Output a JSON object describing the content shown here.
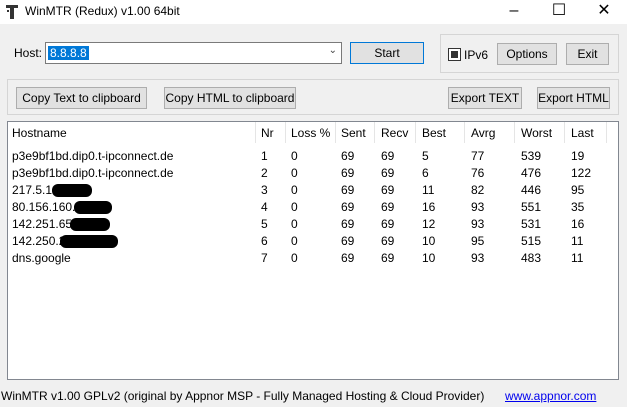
{
  "window": {
    "title": "WinMTR (Redux) v1.00 64bit",
    "minimize_glyph": "–",
    "maximize_glyph": "☐",
    "close_glyph": "✕"
  },
  "host": {
    "label": "Host:",
    "value": "8.8.8.8"
  },
  "buttons": {
    "start": "Start",
    "options": "Options",
    "exit": "Exit",
    "copy_text": "Copy Text to clipboard",
    "copy_html": "Copy HTML to clipboard",
    "export_text": "Export TEXT",
    "export_html": "Export HTML"
  },
  "ipv6": {
    "label": "IPv6",
    "checked": true
  },
  "table": {
    "columns": [
      "Hostname",
      "Nr",
      "Loss %",
      "Sent",
      "Recv",
      "Best",
      "Avrg",
      "Worst",
      "Last"
    ],
    "rows": [
      [
        "p3e9bf1bd.dip0.t-ipconnect.de",
        "1",
        "0",
        "69",
        "69",
        "5",
        "77",
        "539",
        "19"
      ],
      [
        "p3e9bf1bd.dip0.t-ipconnect.de",
        "2",
        "0",
        "69",
        "69",
        "6",
        "76",
        "476",
        "122"
      ],
      [
        "217.5.1",
        "3",
        "0",
        "69",
        "69",
        "11",
        "82",
        "446",
        "95"
      ],
      [
        "80.156.160.",
        "4",
        "0",
        "69",
        "69",
        "16",
        "93",
        "551",
        "35"
      ],
      [
        "142.251.65.",
        "5",
        "0",
        "69",
        "69",
        "12",
        "93",
        "531",
        "16"
      ],
      [
        "142.250.2",
        "6",
        "0",
        "69",
        "69",
        "10",
        "95",
        "515",
        "11"
      ],
      [
        "dns.google",
        "7",
        "0",
        "69",
        "69",
        "10",
        "93",
        "483",
        "11"
      ]
    ]
  },
  "status": {
    "text": "WinMTR v1.00 GPLv2 (original by Appnor MSP - Fully Managed Hosting & Cloud Provider)",
    "link": "www.appnor.com"
  }
}
